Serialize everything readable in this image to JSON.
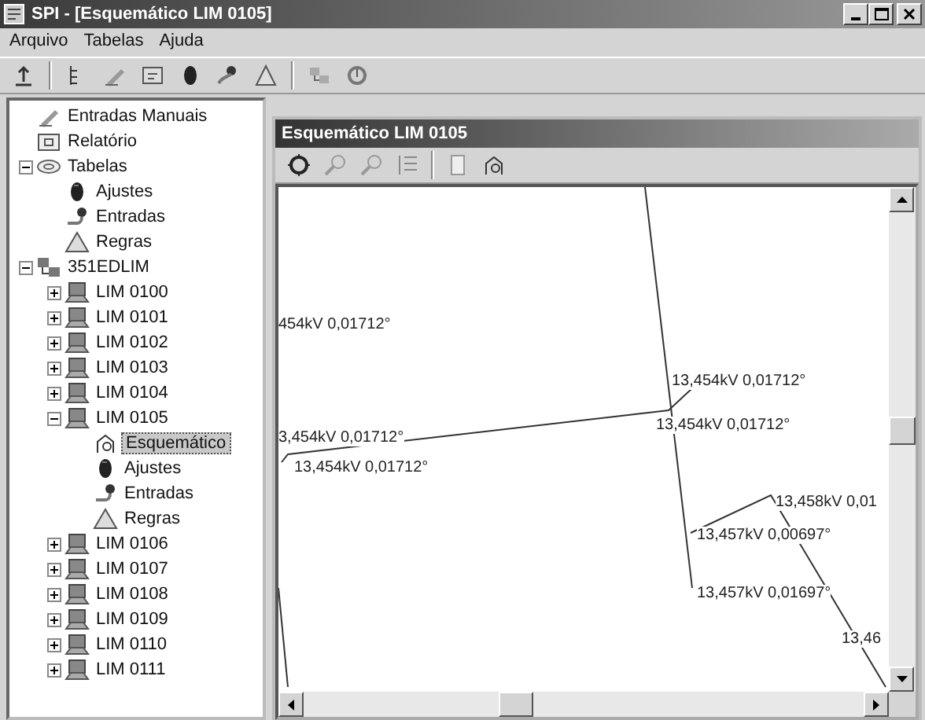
{
  "window": {
    "title": "SPI - [Esquemático LIM  0105]"
  },
  "menu": [
    "Arquivo",
    "Tabelas",
    "Ajuda"
  ],
  "tree": [
    {
      "label": "Entradas Manuais",
      "kind": "pen",
      "selected": false
    },
    {
      "label": "Relatório",
      "kind": "report",
      "selected": false
    },
    {
      "label": "Tabelas",
      "kind": "table",
      "selected": false,
      "expanded": true,
      "children": [
        {
          "label": "Ajustes",
          "kind": "settings",
          "selected": false
        },
        {
          "label": "Entradas",
          "kind": "inputs",
          "selected": false
        },
        {
          "label": "Regras",
          "kind": "rules",
          "selected": false
        }
      ]
    },
    {
      "label": "351EDLIM",
      "kind": "network",
      "selected": false,
      "expanded": true,
      "children": [
        {
          "label": "LIM  0100",
          "kind": "computer",
          "selected": false,
          "expanded": false
        },
        {
          "label": "LIM  0101",
          "kind": "computer",
          "selected": false,
          "expanded": false
        },
        {
          "label": "LIM  0102",
          "kind": "computer",
          "selected": false,
          "expanded": false
        },
        {
          "label": "LIM  0103",
          "kind": "computer",
          "selected": false,
          "expanded": false
        },
        {
          "label": "LIM  0104",
          "kind": "computer",
          "selected": false,
          "expanded": false
        },
        {
          "label": "LIM  0105",
          "kind": "computer",
          "selected": false,
          "expanded": true,
          "children": [
            {
              "label": "Esquemático",
              "kind": "schematic",
              "selected": true
            },
            {
              "label": "Ajustes",
              "kind": "settings",
              "selected": false
            },
            {
              "label": "Entradas",
              "kind": "inputs",
              "selected": false
            },
            {
              "label": "Regras",
              "kind": "rules",
              "selected": false
            }
          ]
        },
        {
          "label": "LIM  0106",
          "kind": "computer",
          "selected": false,
          "expanded": false
        },
        {
          "label": "LIM  0107",
          "kind": "computer",
          "selected": false,
          "expanded": false
        },
        {
          "label": "LIM  0108",
          "kind": "computer",
          "selected": false,
          "expanded": false
        },
        {
          "label": "LIM  0109",
          "kind": "computer",
          "selected": false,
          "expanded": false
        },
        {
          "label": "LIM  0110",
          "kind": "computer",
          "selected": false,
          "expanded": false
        },
        {
          "label": "LIM  0111",
          "kind": "computer",
          "selected": false,
          "expanded": false
        }
      ]
    }
  ],
  "child_window": {
    "title": "Esquemático LIM  0105"
  },
  "schematic_labels": [
    "454kV 0,01712°",
    "13,454kV 0,01712°",
    "13,454kV 0,01712°",
    "3,454kV 0,01712°",
    "13,454kV 0,01712°",
    "13,458kV 0,01",
    "13,457kV 0,00697°",
    "13,457kV 0,01697°",
    "13,46"
  ]
}
